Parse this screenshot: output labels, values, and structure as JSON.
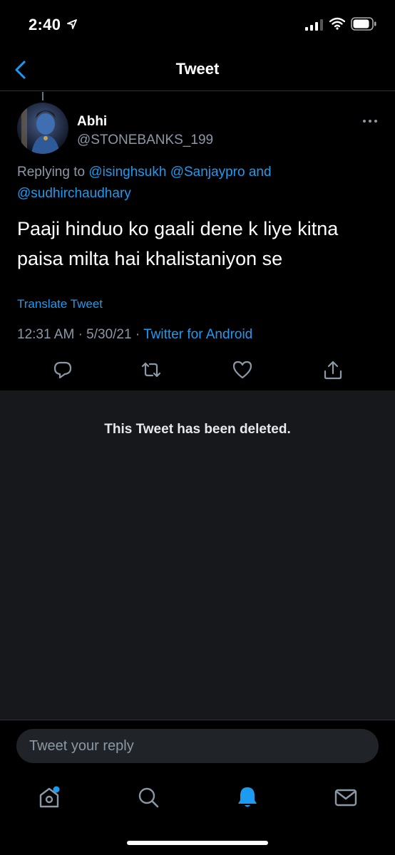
{
  "status_bar": {
    "time": "2:40"
  },
  "nav": {
    "title": "Tweet"
  },
  "tweet": {
    "author_name": "Abhi",
    "author_handle": "@STONEBANKS_199",
    "replying_prefix": "Replying to",
    "mentions": [
      "@isinghsukh",
      "@Sanjaypro"
    ],
    "conjunction": "and",
    "last_mention": "@sudhirchaudhary",
    "text": "Paaji hinduo ko gaali dene k liye kitna paisa milta hai khalistaniyon se",
    "translate_label": "Translate Tweet",
    "time": "12:31 AM",
    "date": "5/30/21",
    "separator": "·",
    "source": "Twitter for Android"
  },
  "actions": {
    "reply_icon": "reply-icon",
    "retweet_icon": "retweet-icon",
    "like_icon": "heart-icon",
    "share_icon": "share-icon"
  },
  "deleted": {
    "message": "This Tweet has been deleted."
  },
  "composer": {
    "placeholder": "Tweet your reply"
  },
  "tabbar": {
    "items": [
      "home-icon",
      "search-icon",
      "notifications-icon",
      "messages-icon"
    ],
    "active": "notifications-icon"
  },
  "colors": {
    "accent": "#1d9bf0",
    "muted": "#8b98a5",
    "panel": "#16181c"
  }
}
